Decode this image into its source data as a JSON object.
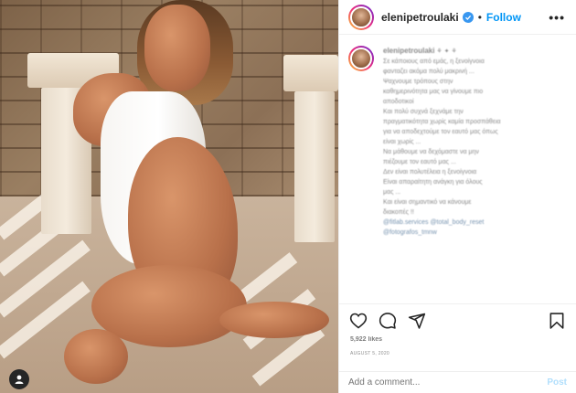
{
  "header": {
    "username": "elenipetroulaki",
    "separator": "•",
    "follow_label": "Follow",
    "more_label": "•••"
  },
  "caption": {
    "username": "elenipetroulaki",
    "lines": [
      "Σε κάποιους από εμάς, η ξενοίγνοια",
      "φανταζει ακόμα πολύ μακρινή ...",
      "Ψαχνουμε τρόπους στην",
      "καθημερινότητα μας να γίνουμε πιο",
      "αποδοτικοί",
      "Και πολύ συχνά ξεχνάμε την",
      "πραγματικότητα χωρίς καμία προσπάθεια",
      "για να αποδεχτούμε τον εαυτό μας όπως",
      "είναι χωρίς ...",
      "Να μάθουμε να δεχόμαστε να μην",
      "πιέζουμε τον εαυτό μας ...",
      "Δεν είναι πολυτέλεια η ξενοίγνοια",
      "Είναι απαραίτητη ανάγκη για όλους",
      "μας ...",
      "Και είναι σημαντικό να κάνουμε",
      "διακοπές !!"
    ],
    "mentions": [
      "@fitlab.services @total_body_reset",
      "@fotografos_tmnw"
    ]
  },
  "actions": {
    "like_icon": "heart-icon",
    "comment_icon": "comment-icon",
    "share_icon": "share-icon",
    "save_icon": "bookmark-icon"
  },
  "likes_text": "5,922 likes",
  "date_text": "August 5, 2020",
  "add_comment": {
    "placeholder": "Add a comment...",
    "post_label": "Post"
  },
  "colors": {
    "accent": "#0095f6",
    "verified": "#3897f0",
    "text": "#262626",
    "muted": "#8e8e8e",
    "post_disabled": "#b2dffc"
  }
}
